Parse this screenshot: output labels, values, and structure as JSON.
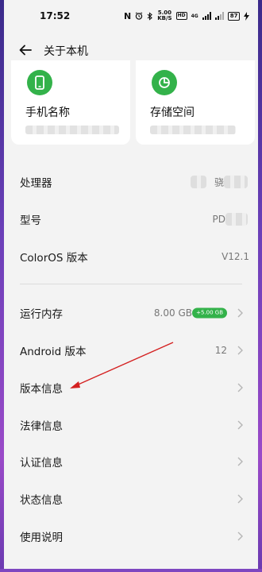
{
  "status_bar": {
    "time": "17:52",
    "nfc": "N",
    "speed_top": "5.00",
    "speed_bottom": "KB/S",
    "hd": "HD",
    "net1": "4G",
    "battery": "87"
  },
  "header": {
    "title": "关于本机",
    "back_icon": "arrow-left-icon"
  },
  "cards": [
    {
      "title": "手机名称",
      "icon": "phone-icon",
      "color": "#33b24a"
    },
    {
      "title": "存储空间",
      "icon": "pie-chart-icon",
      "color": "#33b24a"
    }
  ],
  "info_rows": [
    {
      "label": "处理器",
      "value": "骁"
    },
    {
      "label": "型号",
      "value": "PD"
    },
    {
      "label": "ColorOS 版本",
      "value": "V12.1"
    }
  ],
  "menu_rows": [
    {
      "label": "运行内存",
      "value": "8.00 GB",
      "badge": "+5.00 GB"
    },
    {
      "label": "Android 版本",
      "value": "12"
    },
    {
      "label": "版本信息",
      "value": ""
    },
    {
      "label": "法律信息",
      "value": ""
    },
    {
      "label": "认证信息",
      "value": ""
    },
    {
      "label": "状态信息",
      "value": ""
    },
    {
      "label": "使用说明",
      "value": ""
    }
  ],
  "colors": {
    "accent": "#33b24a",
    "annotation_arrow": "#d42020",
    "background": "#f3f3f3"
  }
}
